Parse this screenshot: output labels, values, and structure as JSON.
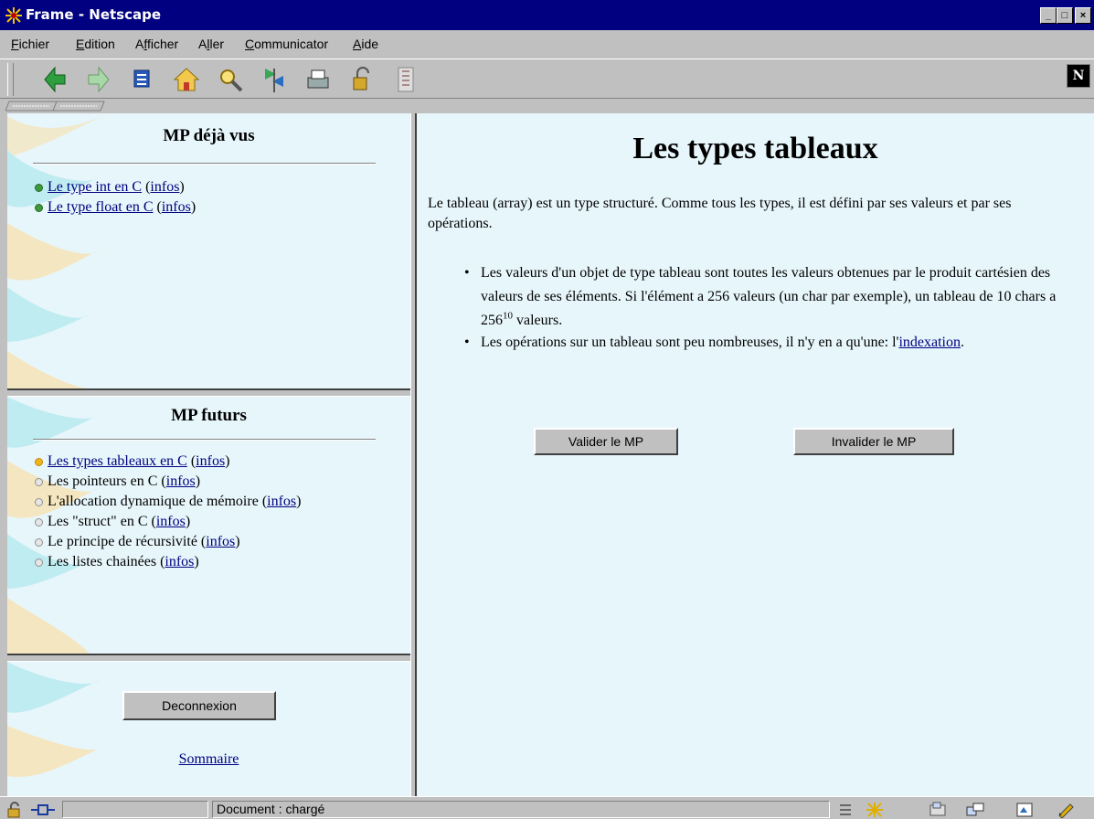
{
  "window": {
    "title": "Frame - Netscape",
    "buttons": [
      "_",
      "□",
      "×"
    ]
  },
  "menu": [
    {
      "label": "Fichier",
      "accel": "F"
    },
    {
      "label": "Edition",
      "accel": "E"
    },
    {
      "label": "Afficher",
      "accel": "f"
    },
    {
      "label": "Aller",
      "accel": "l"
    },
    {
      "label": "Communicator",
      "accel": "C"
    },
    {
      "label": "Aide",
      "accel": "A"
    }
  ],
  "toolbar": {
    "icons": [
      "back-icon",
      "forward-icon",
      "reload-icon",
      "home-icon",
      "search-icon",
      "guide-icon",
      "print-icon",
      "security-icon",
      "stop-icon"
    ],
    "logo": "N"
  },
  "frames": {
    "seen": {
      "heading": "MP déjà vus",
      "items": [
        {
          "title": "Le type int en C",
          "infos": "infos",
          "status": "green"
        },
        {
          "title": "Le type float en C",
          "infos": "infos",
          "status": "green"
        }
      ]
    },
    "future": {
      "heading": "MP futurs",
      "items": [
        {
          "title": "Les types tableaux en C",
          "infos": "infos",
          "status": "yellow",
          "linked": true
        },
        {
          "title": "Les pointeurs en C",
          "infos": "infos",
          "status": "gray"
        },
        {
          "title": "L'allocation dynamique de mémoire",
          "infos": "infos",
          "status": "gray"
        },
        {
          "title": "Les \"struct\" en C",
          "infos": "infos",
          "status": "gray"
        },
        {
          "title": "Le principe de récursivité",
          "infos": "infos",
          "status": "gray"
        },
        {
          "title": "Les listes chainées",
          "infos": "infos",
          "status": "gray"
        }
      ]
    },
    "bottom": {
      "logout_label": "Deconnexion",
      "summary_link": "Sommaire"
    }
  },
  "main": {
    "title": "Les types tableaux",
    "intro": "Le tableau (array) est un type structuré. Comme tous les types, il est défini par ses valeurs et par ses opérations.",
    "bullet1": {
      "text_before": "Les valeurs d'un objet de type tableau sont toutes les valeurs obtenues par le produit cartésien des valeurs de ses éléments. Si l'élément a 256 valeurs (un char par exemple), un tableau de 10 chars a 256",
      "exponent": "10",
      "text_after": " valeurs."
    },
    "bullet2": {
      "text_before": "Les opérations sur un tableau sont peu nombreuses, il n'y en a qu'une: l'",
      "link": "indexation",
      "text_after": "."
    },
    "validate_label": "Valider le MP",
    "invalidate_label": "Invalider le MP"
  },
  "status": {
    "text": "Document : chargé"
  }
}
